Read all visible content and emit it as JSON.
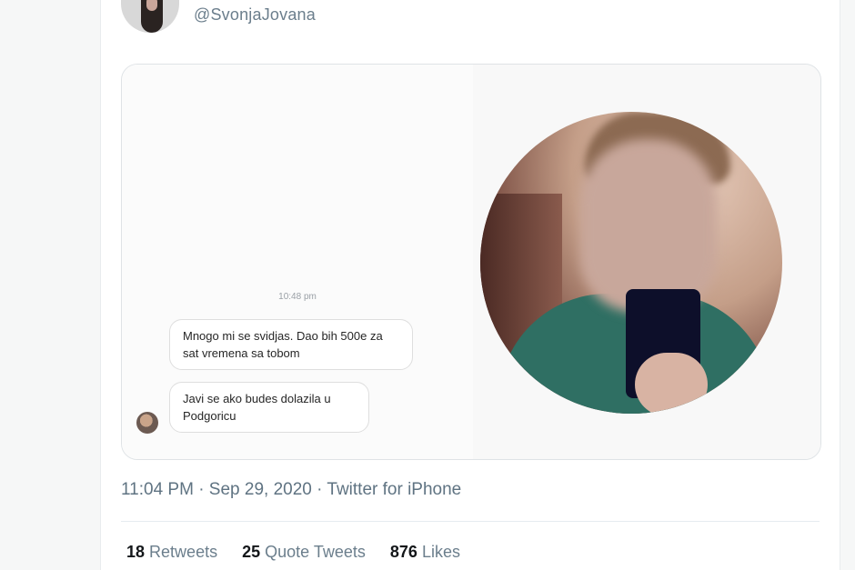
{
  "tweet": {
    "handle": "@SvonjaJovana",
    "timestamp": "11:04 PM · Sep 29, 2020 · Twitter for iPhone",
    "stats": {
      "retweets_count": "18",
      "retweets_label": "Retweets",
      "quote_tweets_count": "25",
      "quote_tweets_label": "Quote Tweets",
      "likes_count": "876",
      "likes_label": "Likes"
    }
  },
  "media": {
    "chat": {
      "time": "10:48 pm",
      "messages": [
        "Mnogo mi se svidjas. Dao bih 500e za sat vremena sa tobom",
        "Javi se ako budes dolazila u Podgoricu"
      ]
    }
  },
  "colors": {
    "text_secondary": "#6b7e8c",
    "text_primary": "#14171a"
  }
}
